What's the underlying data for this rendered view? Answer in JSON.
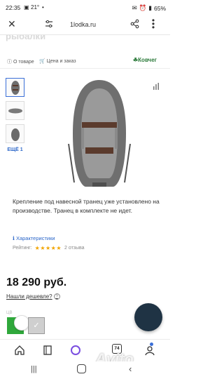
{
  "status": {
    "time": "22:35",
    "temp": "21°",
    "battery": "65%"
  },
  "browser": {
    "url": "1lodka.ru"
  },
  "header": {
    "ghost_text": "рыбалки"
  },
  "tabs": {
    "about": "О товаре",
    "price": "Цена и заказ",
    "brand": "Ковчег"
  },
  "gallery": {
    "more": "ЕЩЁ 1"
  },
  "description": "Крепление под навесной транец уже установлено на производстве. Транец в комплекте не идет.",
  "specs_link": "Характеристики",
  "rating": {
    "label": "Рейтинг:",
    "stars": 5,
    "reviews": "2 отзыва"
  },
  "price": "18 290 руб.",
  "cheaper": "Нашли дешевле?",
  "color_label": "ЦВ",
  "nav": {
    "tabs_count": "74"
  },
  "watermark": "Avito",
  "colors": {
    "link": "#2c67c9",
    "brand_green": "#2b7a3a",
    "star": "#f2a400",
    "swatch_green": "#2fa83b",
    "fab": "#1f3344"
  }
}
